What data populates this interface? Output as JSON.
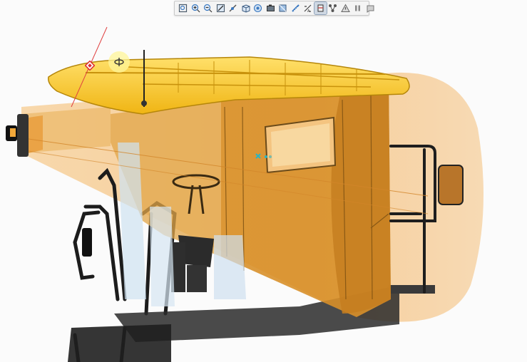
{
  "viewer": {
    "active_tool": "section-tool",
    "colors": {
      "cab_body": "#e0a64a",
      "roof": "#f4c52b",
      "frame": "#1b1b1b",
      "cone_highlight": "#f2a544",
      "axis_marker": "#29b4c4"
    }
  },
  "toolbar": {
    "tools": [
      {
        "name": "zoom-extents-icon"
      },
      {
        "name": "zoom-in-icon"
      },
      {
        "name": "zoom-out-icon"
      },
      {
        "name": "zoom-window-icon"
      },
      {
        "name": "rotate-icon"
      },
      {
        "name": "view-cube-icon"
      },
      {
        "name": "isometric-view-icon"
      },
      {
        "name": "camera-icon"
      },
      {
        "name": "shading-icon"
      },
      {
        "name": "measure-icon"
      },
      {
        "name": "dimension-icon"
      },
      {
        "name": "section-tool-icon"
      },
      {
        "name": "explode-icon"
      },
      {
        "name": "warning-icon"
      },
      {
        "name": "pause-icon"
      },
      {
        "name": "fit-view-icon"
      }
    ]
  }
}
